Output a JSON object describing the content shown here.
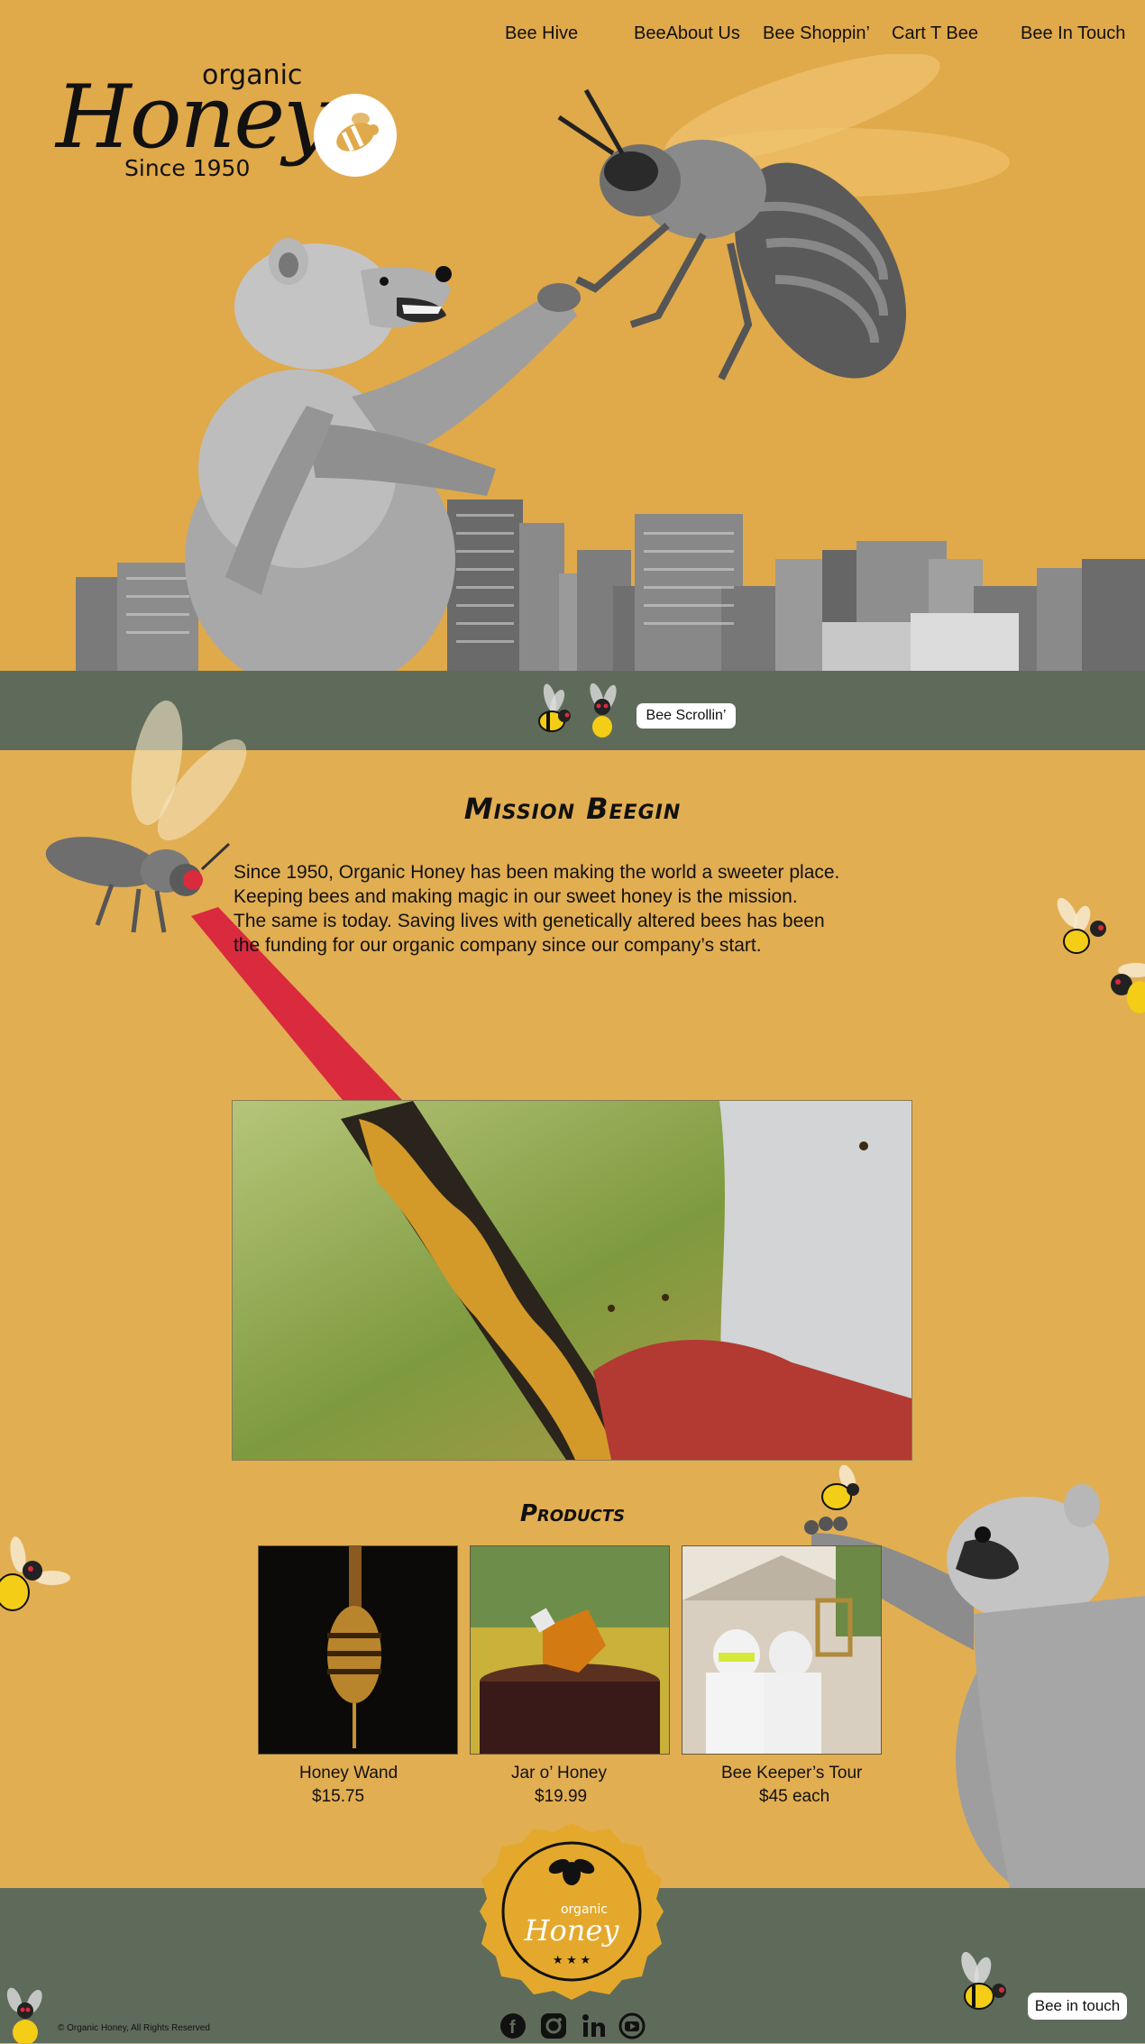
{
  "nav": {
    "items": [
      "Bee Hive",
      "BeeAbout Us",
      "Bee Shoppin’",
      "Cart T Bee",
      "Bee In Touch"
    ]
  },
  "logo": {
    "organic": "organic",
    "honey": "Honey",
    "since": "Since 1950"
  },
  "band": {
    "scroll_label": "Bee Scrollin’"
  },
  "mission": {
    "title": "Mission Beegin",
    "lines": [
      "Since 1950, Organic Honey has been making the world a sweeter place.",
      "Keeping bees and making magic in our sweet honey is the mission.",
      "The same is today. Saving lives with genetically altered bees has been",
      "the funding for our organic company since our company’s start."
    ]
  },
  "products": {
    "title": "Products",
    "items": [
      {
        "name": "Honey Wand",
        "price": "$15.75"
      },
      {
        "name": "Jar o’ Honey",
        "price": "$19.99"
      },
      {
        "name": "Bee Keeper’s Tour",
        "price": "$45 each"
      }
    ]
  },
  "badge": {
    "organic": "organic",
    "honey": "Honey"
  },
  "footer": {
    "copyright": "© Organic Honey, All Rights Reserved",
    "touch_label": "Bee in touch",
    "social_icons": [
      "facebook-icon",
      "instagram-icon",
      "linkedin-icon",
      "youtube-icon"
    ]
  },
  "colors": {
    "hero_bg": "#e0a94a",
    "page_bg": "#e2ae52",
    "band_bg": "#5f6b5a",
    "laser": "#d92a3e",
    "badge_gold": "#e4a92c"
  }
}
